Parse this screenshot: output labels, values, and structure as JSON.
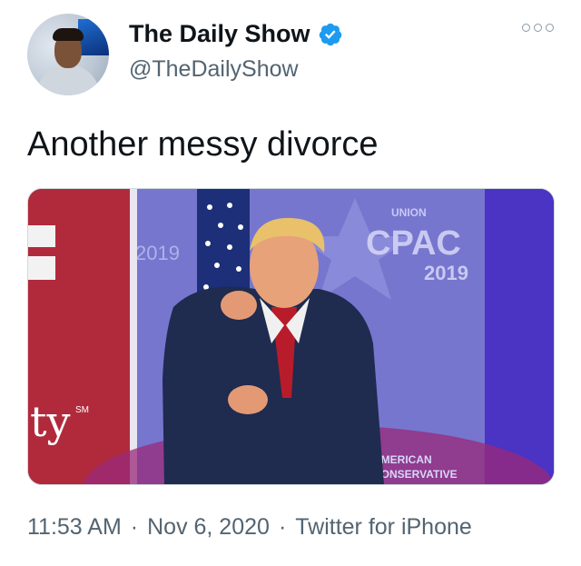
{
  "account": {
    "display_name": "The Daily Show",
    "handle": "@TheDailyShow",
    "verified": true
  },
  "tweet": {
    "text": "Another messy divorce",
    "time": "11:53 AM",
    "date": "Nov 6, 2020",
    "source": "Twitter for iPhone",
    "separator": "·"
  },
  "media": {
    "backdrop_text": {
      "cpac": "CPAC",
      "year": "2019",
      "union": "UNION",
      "american": "AMERICAN",
      "conservative": "CONSERVATIVE",
      "left_fragment": "ty",
      "left_sm": "SM"
    }
  },
  "colors": {
    "verified_blue": "#1d9bf0",
    "secondary_text": "#536471"
  },
  "icons": {
    "more": "more-options-icon",
    "verified": "verified-badge-icon"
  }
}
